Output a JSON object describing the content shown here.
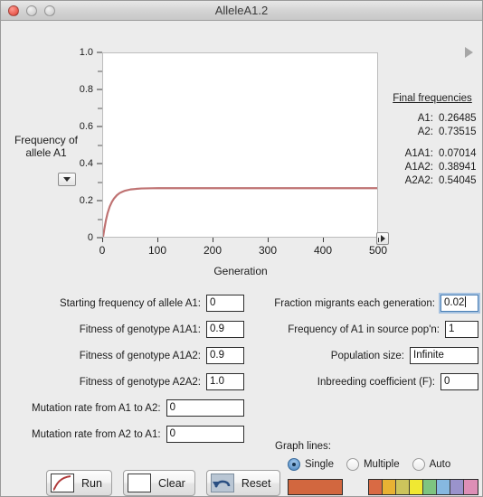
{
  "window": {
    "title": "AlleleA1.2",
    "traffic_lights": [
      "close",
      "minimize",
      "zoom"
    ]
  },
  "graph": {
    "y_axis_title": "Frequency of\nallele A1",
    "y_axis_title_line1": "Frequency of",
    "y_axis_title_line2": "allele A1",
    "x_axis_title": "Generation",
    "y_ticks": [
      "1.0",
      "0.8",
      "0.6",
      "0.4",
      "0.2",
      "0"
    ],
    "x_ticks": [
      "0",
      "100",
      "200",
      "300",
      "400",
      "500"
    ],
    "line_color": "#bf7272"
  },
  "chart_data": {
    "type": "line",
    "title": "",
    "xlabel": "Generation",
    "ylabel": "Frequency of allele A1",
    "xlim": [
      0,
      500
    ],
    "ylim": [
      0,
      1.0
    ],
    "xticks": [
      0,
      100,
      200,
      300,
      400,
      500
    ],
    "yticks": [
      0,
      0.2,
      0.4,
      0.6,
      0.8,
      1.0
    ],
    "grid": false,
    "legend": "none",
    "series": [
      {
        "name": "Frequency of allele A1",
        "color": "#bf7272",
        "x": [
          0,
          2,
          5,
          8,
          12,
          16,
          20,
          25,
          30,
          35,
          40,
          50,
          60,
          70,
          80,
          90,
          100,
          120,
          150,
          200,
          250,
          300,
          350,
          400,
          450,
          500
        ],
        "y": [
          0.0,
          0.038,
          0.088,
          0.127,
          0.164,
          0.19,
          0.209,
          0.226,
          0.238,
          0.245,
          0.251,
          0.258,
          0.261,
          0.2632,
          0.264,
          0.2645,
          0.2647,
          0.2648,
          0.26485,
          0.26485,
          0.26485,
          0.26485,
          0.26485,
          0.26485,
          0.26485,
          0.26485
        ]
      }
    ]
  },
  "final_frequencies": {
    "title": "Final frequencies",
    "allele_rows": [
      {
        "key": "A1:",
        "value": "0.26485"
      },
      {
        "key": "A2:",
        "value": "0.73515"
      }
    ],
    "genotype_rows": [
      {
        "key": "A1A1:",
        "value": "0.07014"
      },
      {
        "key": "A1A2:",
        "value": "0.38941"
      },
      {
        "key": "A2A2:",
        "value": "0.54045"
      }
    ]
  },
  "params_left": [
    {
      "label": "Starting frequency of allele A1:",
      "value": "0",
      "width": "w-medium",
      "focused": false
    },
    {
      "label": "Fitness of genotype A1A1:",
      "value": "0.9",
      "width": "w-medium",
      "focused": false
    },
    {
      "label": "Fitness of genotype A1A2:",
      "value": "0.9",
      "width": "w-medium",
      "focused": false
    },
    {
      "label": "Fitness of genotype A2A2:",
      "value": "1.0",
      "width": "w-medium",
      "focused": false
    },
    {
      "label": "Mutation rate from A1 to A2:",
      "value": "0",
      "width": "w-xwide",
      "focused": false
    },
    {
      "label": "Mutation rate from A2 to A1:",
      "value": "0",
      "width": "w-xwide",
      "focused": false
    }
  ],
  "params_right": [
    {
      "label": "Fraction migrants each generation:",
      "value": "0.02",
      "width": "w-medium",
      "focused": true
    },
    {
      "label": "Frequency of A1 in source pop'n:",
      "value": "1",
      "width": "w-narrow",
      "focused": false
    },
    {
      "label": "Population size:",
      "value": "Infinite",
      "width": "w-wide",
      "focused": false
    },
    {
      "label": "Inbreeding coefficient (F):",
      "value": "0",
      "width": "w-medium",
      "focused": false
    }
  ],
  "buttons": [
    {
      "label": "Run",
      "icon": "curve-icon"
    },
    {
      "label": "Clear",
      "icon": "empty-box-icon"
    },
    {
      "label": "Reset",
      "icon": "undo-arrow-icon"
    }
  ],
  "graph_lines": {
    "label": "Graph lines:",
    "options": [
      {
        "label": "Single",
        "selected": true
      },
      {
        "label": "Multiple",
        "selected": false
      },
      {
        "label": "Auto",
        "selected": false
      }
    ],
    "single_color": "#d2673f",
    "palette": [
      "#d96a44",
      "#e8b233",
      "#ccc45c",
      "#f0e832",
      "#7ec480",
      "#86b8e0",
      "#9a93cc",
      "#dd8fb6"
    ]
  }
}
